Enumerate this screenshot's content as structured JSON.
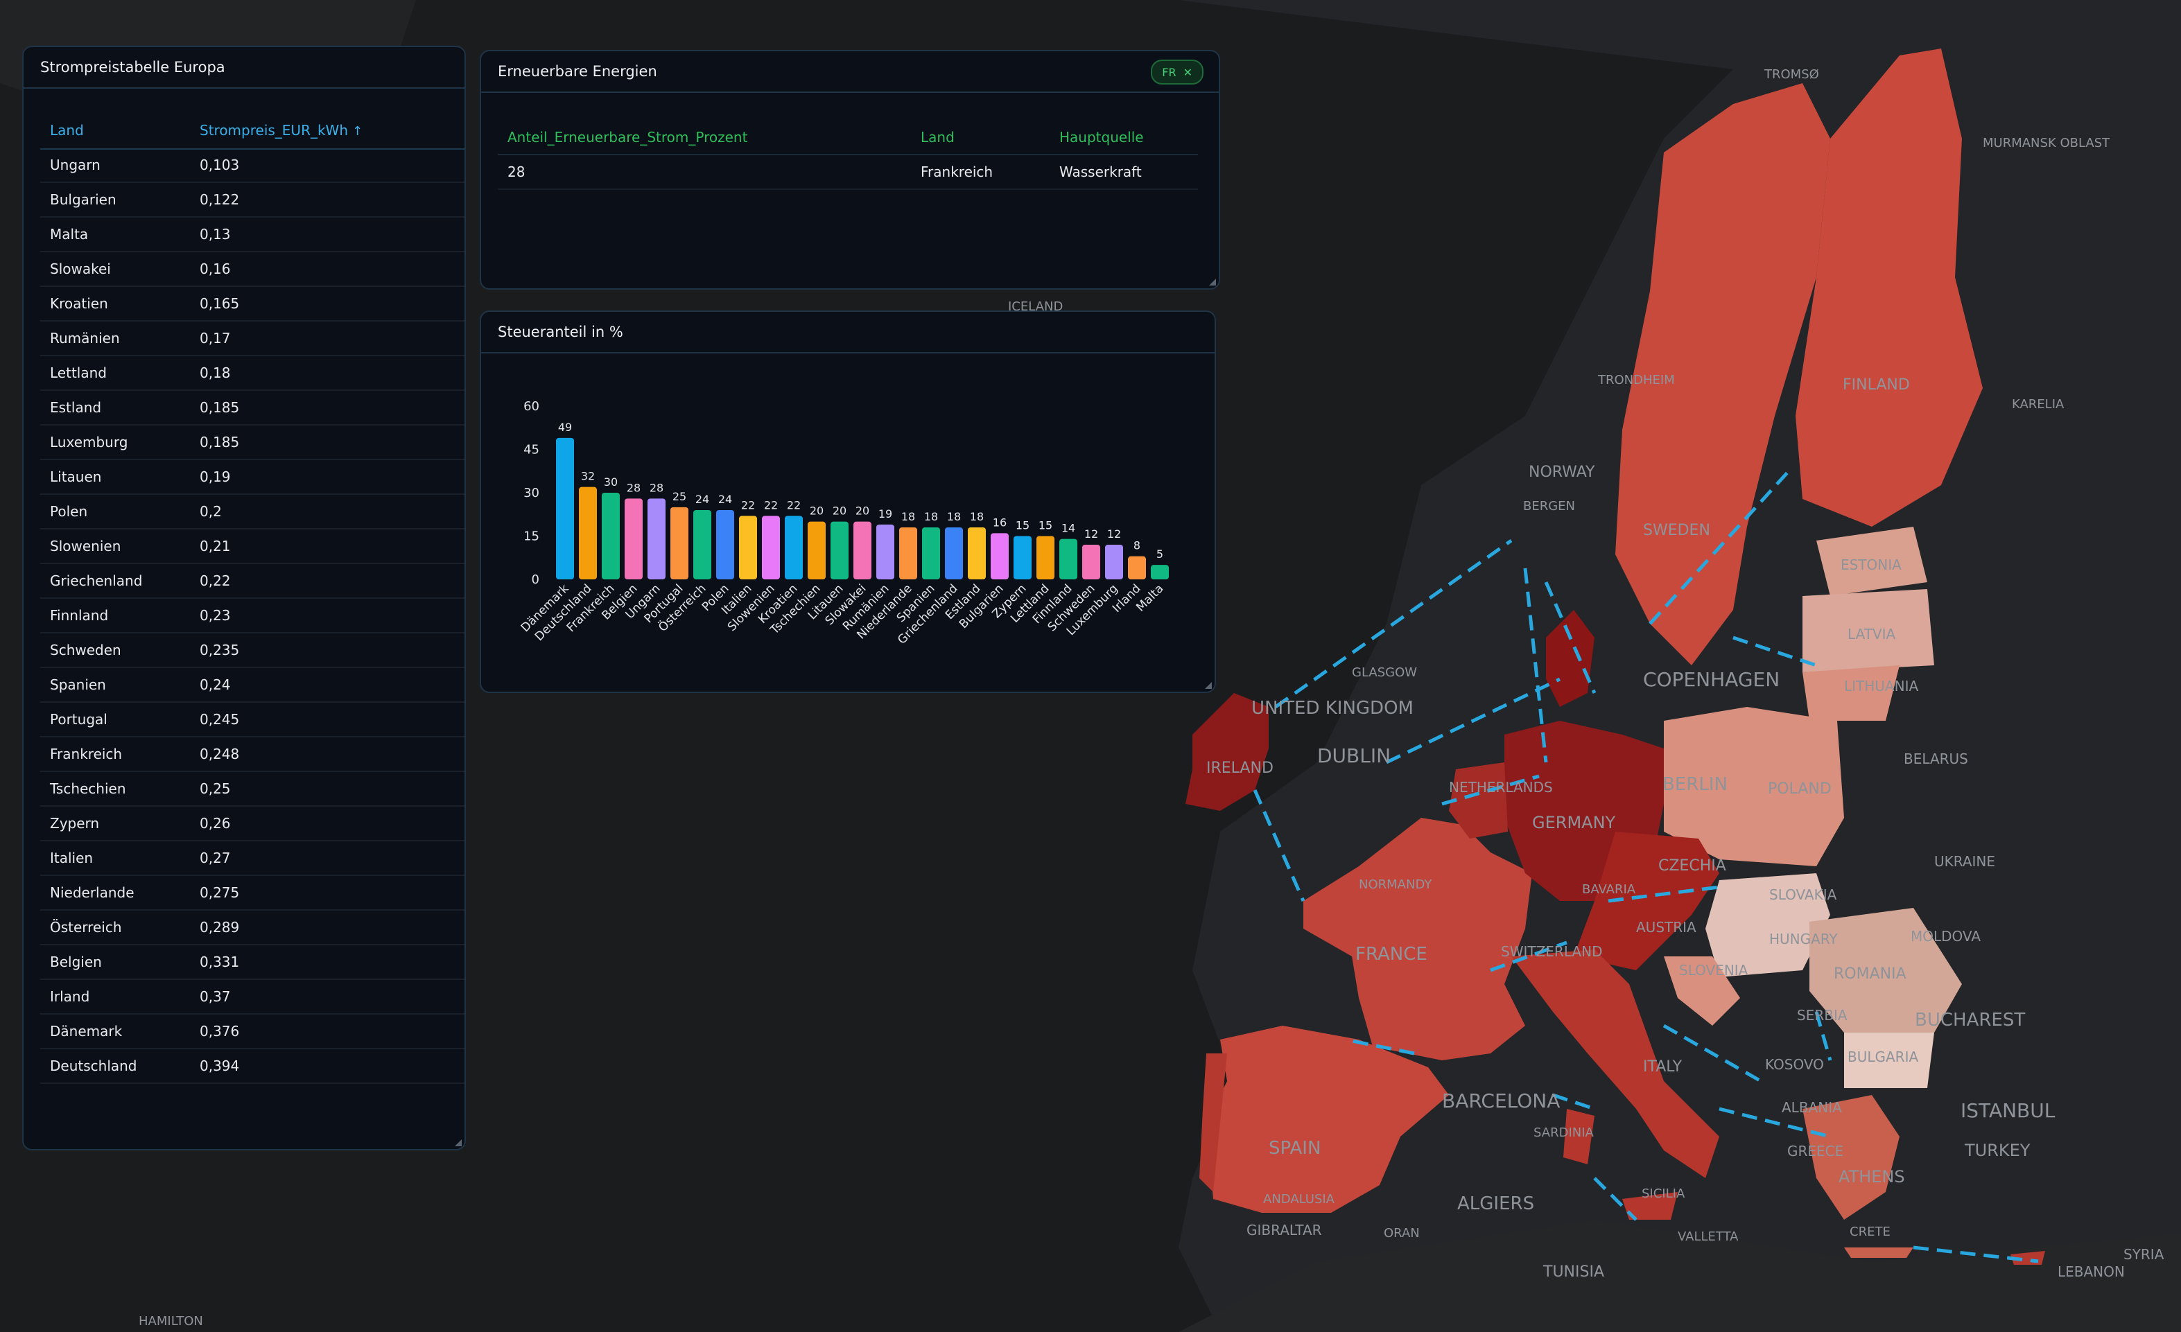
{
  "price_table": {
    "title": "Strompreistabelle Europa",
    "col_land": "Land",
    "col_price": "Strompreis_EUR_kWh",
    "rows": [
      {
        "land": "Ungarn",
        "price": "0,103"
      },
      {
        "land": "Bulgarien",
        "price": "0,122"
      },
      {
        "land": "Malta",
        "price": "0,13"
      },
      {
        "land": "Slowakei",
        "price": "0,16"
      },
      {
        "land": "Kroatien",
        "price": "0,165"
      },
      {
        "land": "Rumänien",
        "price": "0,17"
      },
      {
        "land": "Lettland",
        "price": "0,18"
      },
      {
        "land": "Estland",
        "price": "0,185"
      },
      {
        "land": "Luxemburg",
        "price": "0,185"
      },
      {
        "land": "Litauen",
        "price": "0,19"
      },
      {
        "land": "Polen",
        "price": "0,2"
      },
      {
        "land": "Slowenien",
        "price": "0,21"
      },
      {
        "land": "Griechenland",
        "price": "0,22"
      },
      {
        "land": "Finnland",
        "price": "0,23"
      },
      {
        "land": "Schweden",
        "price": "0,235"
      },
      {
        "land": "Spanien",
        "price": "0,24"
      },
      {
        "land": "Portugal",
        "price": "0,245"
      },
      {
        "land": "Frankreich",
        "price": "0,248"
      },
      {
        "land": "Tschechien",
        "price": "0,25"
      },
      {
        "land": "Zypern",
        "price": "0,26"
      },
      {
        "land": "Italien",
        "price": "0,27"
      },
      {
        "land": "Niederlande",
        "price": "0,275"
      },
      {
        "land": "Österreich",
        "price": "0,289"
      },
      {
        "land": "Belgien",
        "price": "0,331"
      },
      {
        "land": "Irland",
        "price": "0,37"
      },
      {
        "land": "Dänemark",
        "price": "0,376"
      },
      {
        "land": "Deutschland",
        "price": "0,394"
      }
    ]
  },
  "renewables": {
    "title": "Erneuerbare Energien",
    "filter_badge": "FR",
    "col1": "Anteil_Erneuerbare_Strom_Prozent",
    "col2": "Land",
    "col3": "Hauptquelle",
    "row": {
      "percent": "28",
      "land": "Frankreich",
      "source": "Wasserkraft"
    }
  },
  "tax_panel": {
    "title": "Steueranteil in %"
  },
  "chart_data": {
    "type": "bar",
    "title": "Steueranteil in %",
    "categories": [
      "Dänemark",
      "Deutschland",
      "Frankreich",
      "Belgien",
      "Ungarn",
      "Portugal",
      "Österreich",
      "Polen",
      "Italien",
      "Slowenien",
      "Kroatien",
      "Tschechien",
      "Litauen",
      "Slowakei",
      "Rumänien",
      "Niederlande",
      "Spanien",
      "Griechenland",
      "Estland",
      "Bulgarien",
      "Zypern",
      "Lettland",
      "Finnland",
      "Schweden",
      "Luxemburg",
      "Irland",
      "Malta"
    ],
    "values": [
      49,
      32,
      30,
      28,
      28,
      25,
      24,
      24,
      22,
      22,
      22,
      20,
      20,
      20,
      19,
      18,
      18,
      18,
      18,
      16,
      15,
      15,
      14,
      12,
      12,
      8,
      5
    ],
    "colors": [
      "#0ea5e9",
      "#f59e0b",
      "#10b981",
      "#f472b6",
      "#a78bfa",
      "#fb923c",
      "#10b981",
      "#3b82f6",
      "#fbbf24",
      "#e879f9",
      "#0ea5e9",
      "#f59e0b",
      "#10b981",
      "#f472b6",
      "#a78bfa",
      "#fb923c",
      "#10b981",
      "#3b82f6",
      "#fbbf24",
      "#e879f9",
      "#0ea5e9",
      "#f59e0b",
      "#10b981",
      "#f472b6",
      "#a78bfa",
      "#fb923c",
      "#10b981"
    ],
    "yticks": [
      0,
      15,
      30,
      45,
      60
    ],
    "ylim": [
      0,
      60
    ]
  },
  "map_labels": [
    {
      "text": "UNITED KINGDOM"
    },
    {
      "text": "DUBLIN"
    },
    {
      "text": "IRELAND"
    },
    {
      "text": "FRANCE"
    },
    {
      "text": "SPAIN"
    },
    {
      "text": "BARCELONA"
    },
    {
      "text": "GERMANY"
    },
    {
      "text": "BERLIN"
    },
    {
      "text": "POLAND"
    },
    {
      "text": "COPENHAGEN"
    },
    {
      "text": "SWEDEN"
    },
    {
      "text": "FINLAND"
    },
    {
      "text": "NORWAY"
    },
    {
      "text": "ESTONIA"
    },
    {
      "text": "LATVIA"
    },
    {
      "text": "LITHUANIA"
    },
    {
      "text": "CZECHIA"
    },
    {
      "text": "SLOVAKIA"
    },
    {
      "text": "HUNGARY"
    },
    {
      "text": "ROMANIA"
    },
    {
      "text": "BULGARIA"
    },
    {
      "text": "ITALY"
    },
    {
      "text": "GREECE"
    },
    {
      "text": "ATHENS"
    },
    {
      "text": "ISTANBUL"
    },
    {
      "text": "TURKEY"
    },
    {
      "text": "ALGIERS"
    },
    {
      "text": "TUNISIA"
    },
    {
      "text": "BELARUS"
    },
    {
      "text": "UKRAINE"
    },
    {
      "text": "MOLDOVA"
    },
    {
      "text": "SERBIA"
    },
    {
      "text": "BUCHAREST"
    },
    {
      "text": "GIBRALTAR"
    },
    {
      "text": "ICELAND"
    },
    {
      "text": "BERGEN"
    },
    {
      "text": "TRONDHEIM"
    },
    {
      "text": "GLASGOW"
    },
    {
      "text": "KARELIA"
    },
    {
      "text": "TROMSØ"
    },
    {
      "text": "MURMANSK OBLAST"
    },
    {
      "text": "NETHERLANDS"
    },
    {
      "text": "AUSTRIA"
    },
    {
      "text": "SWITZERLAND"
    },
    {
      "text": "CRETE"
    },
    {
      "text": "LEBANON"
    },
    {
      "text": "SYRIA"
    },
    {
      "text": "HAMILTON"
    },
    {
      "text": "ALBANIA"
    },
    {
      "text": "KOSOVO"
    },
    {
      "text": "SLOVENIA"
    },
    {
      "text": "NORMANDY"
    },
    {
      "text": "BAVARIA"
    },
    {
      "text": "SARDINIA"
    },
    {
      "text": "SICILIA"
    },
    {
      "text": "VALLETTA"
    },
    {
      "text": "ORAN"
    },
    {
      "text": "ANDALUSIA"
    }
  ]
}
